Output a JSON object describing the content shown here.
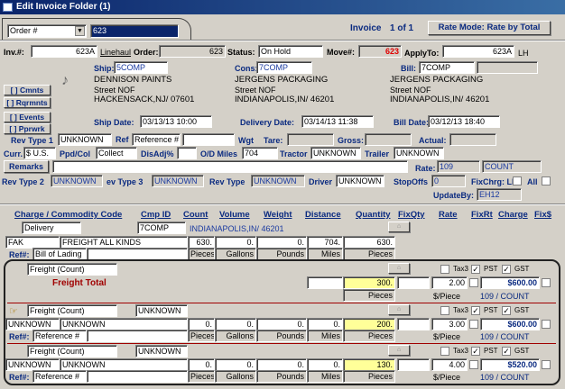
{
  "window": {
    "title": "Edit Invoice Folder (1)"
  },
  "toolbar": {
    "order_select": "Order #",
    "order_value": "623",
    "invoice_label": "Invoice",
    "invoice_page": "1 of 1",
    "rate_mode": "Rate Mode: Rate by Total"
  },
  "header": {
    "inv_label": "Inv.#:",
    "inv_value": "623A",
    "linehaul": "Linehaul",
    "order_label": "Order:",
    "order_value": "623",
    "status_label": "Status:",
    "status_value": "On Hold",
    "move_label": "Move#:",
    "move_value": "623",
    "applyto_label": "ApplyTo:",
    "applyto_value": "623A",
    "applyto_suffix": "LH"
  },
  "ship": {
    "label": "Ship:",
    "code": "5COMP",
    "name": "DENNISON PAINTS",
    "street": "Street NOF",
    "city": "HACKENSACK,NJ/ 07601",
    "date_label": "Ship Date:",
    "date": "03/13/13 10:00"
  },
  "cons": {
    "label": "Cons:",
    "code": "7COMP",
    "name": "JERGENS PACKAGING",
    "street": "Street NOF",
    "city": "INDIANAPOLIS,IN/ 46201",
    "date_label": "Delivery Date:",
    "date": "03/14/13 11:38"
  },
  "bill": {
    "label": "Bill:",
    "code": "7COMP",
    "name": "JERGENS PACKAGING",
    "street": "Street NOF",
    "city": "INDIANAPOLIS,IN/ 46201",
    "date_label": "Bill Date:",
    "date": "03/12/13 18:40"
  },
  "side_buttons": [
    "[ ] Cmnts",
    "[ ] Rqrmnts",
    "[ ] Events",
    "[ ] Pprwrk"
  ],
  "fields": {
    "rev_type1_label": "Rev Type 1",
    "rev_type1": "UNKNOWN",
    "ref_label": "Ref",
    "ref_value": "Reference #",
    "wgt_label": "Wgt",
    "tare_label": "Tare:",
    "gross_label": "Gross:",
    "actual_label": "Actual:",
    "curr_label": "Curr.",
    "curr_value": "$ U.S.",
    "ppdcol_label": "Ppd/Col",
    "ppdcol_value": "Collect",
    "disadj_label": "DisAdj%",
    "od_miles_label": "O/D Miles",
    "od_miles_value": "704",
    "tractor_label": "Tractor",
    "tractor_value": "UNKNOWN",
    "trailer_label": "Trailer",
    "trailer_value": "UNKNOWN",
    "remarks_btn": "Remarks",
    "rate_label": "Rate:",
    "rate_value": "109",
    "rate_unit": "COUNT",
    "rev_type2_label": "Rev Type 2",
    "rev_type2": "UNKNOWN",
    "rev_type3_label": "ev Type 3",
    "rev_type3": "UNKNOWN",
    "rev_type_label": "Rev Type",
    "rev_type": "UNKNOWN",
    "driver_label": "Driver",
    "driver_value": "UNKNOWN",
    "stopoffs_label": "StopOffs",
    "stopoffs_value": "0",
    "fixchrg_label": "FixChrg: LH",
    "all_label": "All",
    "updateby_label": "UpdateBy:",
    "updateby_value": "EH12"
  },
  "columns": [
    "Charge / Commodity Code",
    "Cmp ID",
    "Count",
    "Volume",
    "Weight",
    "Distance",
    "Quantity",
    "FixQty",
    "Rate",
    "FixRt",
    "Charge",
    "Fix$"
  ],
  "delivery": {
    "type": "Delivery",
    "cmp_id": "7COMP",
    "cmp_city": "INDIANAPOLIS,IN/  46201",
    "code": "FAK",
    "desc": "FREIGHT ALL KINDS",
    "count": "630.",
    "volume": "0.",
    "weight": "0.",
    "distance": "704.",
    "quantity": "630.",
    "ref_label": "Ref#:",
    "ref_type": "Bill of Lading",
    "units": [
      "Pieces",
      "Gallons",
      "Pounds",
      "Miles",
      "Pieces"
    ]
  },
  "freight_total": {
    "type": "Freight (Count)",
    "label": "Freight Total",
    "quantity": "300.",
    "rate": "2.00",
    "charge": "$600.00",
    "unit": "Pieces",
    "rate_unit": "$/Piece",
    "rate_desc": "109 / COUNT"
  },
  "taxes": {
    "tax3": "Tax3",
    "pst": "PST",
    "gst": "GST"
  },
  "freight_rows": [
    {
      "type": "Freight (Count)",
      "cmp": "UNKNOWN",
      "code": "UNKNOWN",
      "desc": "UNKNOWN",
      "count": "0.",
      "volume": "0.",
      "weight": "0.",
      "distance": "0.",
      "quantity": "200.",
      "rate": "3.00",
      "charge": "$600.00",
      "ref_label": "Ref#:",
      "ref_type": "Reference #",
      "units": [
        "Pieces",
        "Gallons",
        "Pounds",
        "Miles",
        "Pieces"
      ],
      "rate_unit": "$/Piece",
      "rate_desc": "109 / COUNT"
    },
    {
      "type": "Freight (Count)",
      "cmp": "UNKNOWN",
      "code": "UNKNOWN",
      "desc": "UNKNOWN",
      "count": "0.",
      "volume": "0.",
      "weight": "0.",
      "distance": "0.",
      "quantity": "130.",
      "rate": "4.00",
      "charge": "$520.00",
      "ref_label": "Ref#:",
      "ref_type": "Reference #",
      "units": [
        "Pieces",
        "Gallons",
        "Pounds",
        "Miles",
        "Pieces"
      ],
      "rate_unit": "$/Piece",
      "rate_desc": "109 / COUNT"
    }
  ],
  "colors": {
    "title_bar": "#0a246a",
    "move_red": "#e00000",
    "navy_label": "#0a2a80",
    "highlight": "#ffff99"
  }
}
